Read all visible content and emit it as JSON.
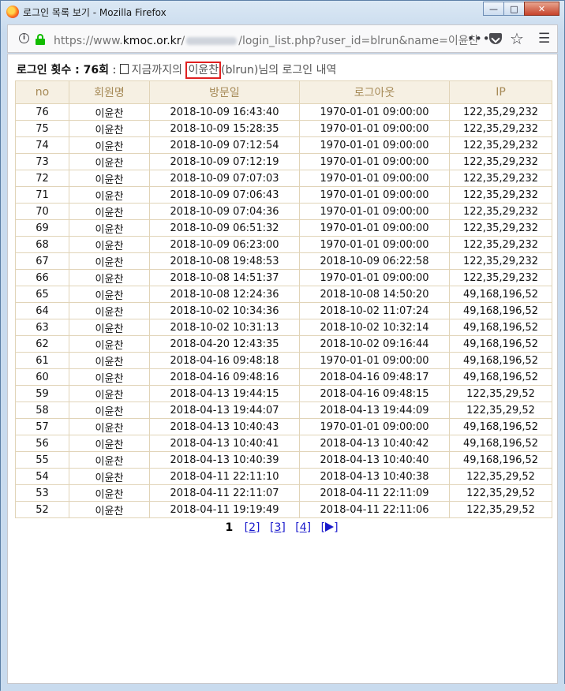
{
  "window": {
    "title": "로그인 목록 보기 - Mozilla Firefox",
    "minimize": "—",
    "maximize": "□",
    "close": "✕"
  },
  "navbar": {
    "url_prefix": "https://www.",
    "url_host": "kmoc.or.kr",
    "url_slash": "/",
    "url_rest": "/login_list.php?user_id=blrun&name=이윤찬",
    "more": "•••",
    "star": "☆",
    "menu": "☰",
    "info": "i"
  },
  "heading": {
    "count_label": "로그인 횟수 : ",
    "count": "76회",
    "sep": " : ",
    "desc_before": "지금까지의 ",
    "name": "이윤찬",
    "desc_after": "(blrun)님의 로그인 내역"
  },
  "table": {
    "headers": [
      "no",
      "회원명",
      "방문일",
      "로그아웃",
      "IP"
    ],
    "rows": [
      [
        "76",
        "이윤찬",
        "2018-10-09 16:43:40",
        "1970-01-01 09:00:00",
        "122,35,29,232"
      ],
      [
        "75",
        "이윤찬",
        "2018-10-09 15:28:35",
        "1970-01-01 09:00:00",
        "122,35,29,232"
      ],
      [
        "74",
        "이윤찬",
        "2018-10-09 07:12:54",
        "1970-01-01 09:00:00",
        "122,35,29,232"
      ],
      [
        "73",
        "이윤찬",
        "2018-10-09 07:12:19",
        "1970-01-01 09:00:00",
        "122,35,29,232"
      ],
      [
        "72",
        "이윤찬",
        "2018-10-09 07:07:03",
        "1970-01-01 09:00:00",
        "122,35,29,232"
      ],
      [
        "71",
        "이윤찬",
        "2018-10-09 07:06:43",
        "1970-01-01 09:00:00",
        "122,35,29,232"
      ],
      [
        "70",
        "이윤찬",
        "2018-10-09 07:04:36",
        "1970-01-01 09:00:00",
        "122,35,29,232"
      ],
      [
        "69",
        "이윤찬",
        "2018-10-09 06:51:32",
        "1970-01-01 09:00:00",
        "122,35,29,232"
      ],
      [
        "68",
        "이윤찬",
        "2018-10-09 06:23:00",
        "1970-01-01 09:00:00",
        "122,35,29,232"
      ],
      [
        "67",
        "이윤찬",
        "2018-10-08 19:48:53",
        "2018-10-09 06:22:58",
        "122,35,29,232"
      ],
      [
        "66",
        "이윤찬",
        "2018-10-08 14:51:37",
        "1970-01-01 09:00:00",
        "122,35,29,232"
      ],
      [
        "65",
        "이윤찬",
        "2018-10-08 12:24:36",
        "2018-10-08 14:50:20",
        "49,168,196,52"
      ],
      [
        "64",
        "이윤찬",
        "2018-10-02 10:34:36",
        "2018-10-02 11:07:24",
        "49,168,196,52"
      ],
      [
        "63",
        "이윤찬",
        "2018-10-02 10:31:13",
        "2018-10-02 10:32:14",
        "49,168,196,52"
      ],
      [
        "62",
        "이윤찬",
        "2018-04-20 12:43:35",
        "2018-10-02 09:16:44",
        "49,168,196,52"
      ],
      [
        "61",
        "이윤찬",
        "2018-04-16 09:48:18",
        "1970-01-01 09:00:00",
        "49,168,196,52"
      ],
      [
        "60",
        "이윤찬",
        "2018-04-16 09:48:16",
        "2018-04-16 09:48:17",
        "49,168,196,52"
      ],
      [
        "59",
        "이윤찬",
        "2018-04-13 19:44:15",
        "2018-04-16 09:48:15",
        "122,35,29,52"
      ],
      [
        "58",
        "이윤찬",
        "2018-04-13 19:44:07",
        "2018-04-13 19:44:09",
        "122,35,29,52"
      ],
      [
        "57",
        "이윤찬",
        "2018-04-13 10:40:43",
        "1970-01-01 09:00:00",
        "49,168,196,52"
      ],
      [
        "56",
        "이윤찬",
        "2018-04-13 10:40:41",
        "2018-04-13 10:40:42",
        "49,168,196,52"
      ],
      [
        "55",
        "이윤찬",
        "2018-04-13 10:40:39",
        "2018-04-13 10:40:40",
        "49,168,196,52"
      ],
      [
        "54",
        "이윤찬",
        "2018-04-11 22:11:10",
        "2018-04-13 10:40:38",
        "122,35,29,52"
      ],
      [
        "53",
        "이윤찬",
        "2018-04-11 22:11:07",
        "2018-04-11 22:11:09",
        "122,35,29,52"
      ],
      [
        "52",
        "이윤찬",
        "2018-04-11 19:19:49",
        "2018-04-11 22:11:06",
        "122,35,29,52"
      ]
    ]
  },
  "pager": {
    "current": "1",
    "pages": [
      "2",
      "3",
      "4"
    ]
  },
  "colors": {
    "header_bg": "#f6f0e3",
    "header_text": "#a68a57",
    "border": "#e1d4b8",
    "link": "#1a1acc",
    "highlight_box": "#e02020"
  }
}
